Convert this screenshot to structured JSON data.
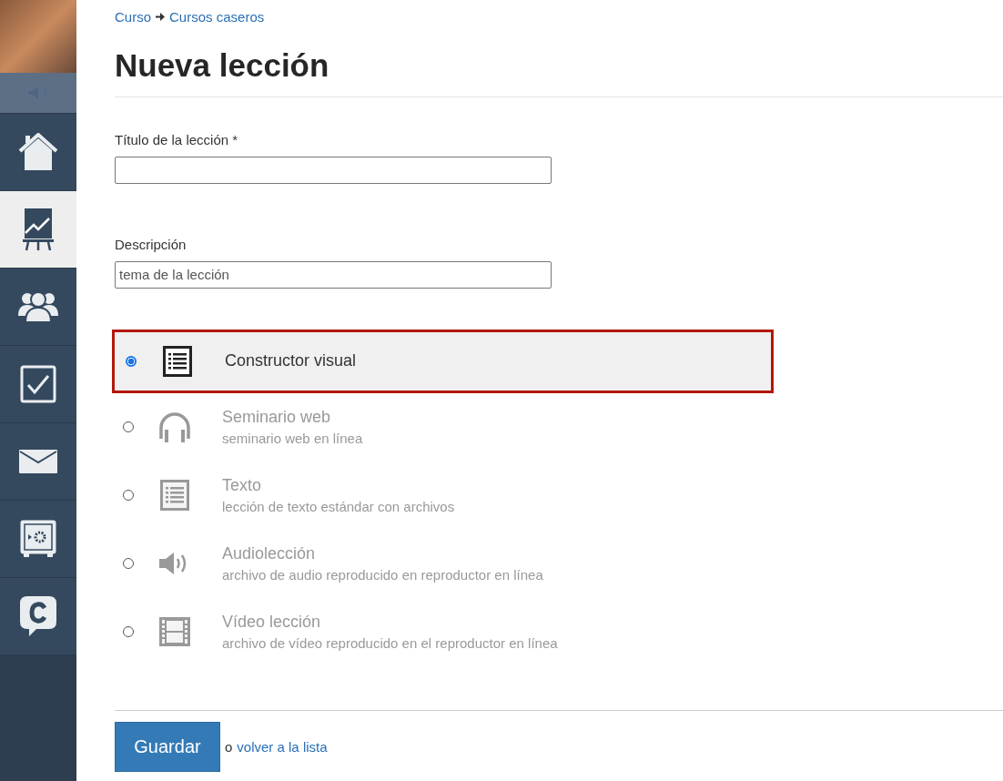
{
  "sidebar": {
    "items": [
      {
        "kind": "home",
        "selected": false
      },
      {
        "kind": "chart",
        "selected": true
      },
      {
        "kind": "users",
        "selected": false
      },
      {
        "kind": "tasks",
        "selected": false
      },
      {
        "kind": "mail",
        "selected": false
      },
      {
        "kind": "safe",
        "selected": false
      },
      {
        "kind": "chat",
        "selected": false
      }
    ]
  },
  "breadcrumb": [
    "Curso",
    "Cursos caseros"
  ],
  "heading": "Nueva lección",
  "fields": [
    {
      "label": "Título de la lección *"
    },
    {
      "label": "Descripción",
      "placeholder": "tema de la lección"
    }
  ],
  "lesson_types": [
    {
      "kind": "builder",
      "title": "Constructor visual",
      "selected": true
    },
    {
      "kind": "webinar",
      "title": "Seminario web",
      "description": "seminario web en línea",
      "selected": false
    },
    {
      "kind": "text",
      "title": "Texto",
      "description": "lección de texto estándar con archivos",
      "selected": false
    },
    {
      "kind": "audio",
      "title": "Audiolección",
      "description": "archivo de audio reproducido en reproductor en línea",
      "selected": false
    },
    {
      "kind": "video",
      "title": "Vídeo lección",
      "description": "archivo de vídeo reproducido en el reproductor en línea",
      "selected": false
    }
  ],
  "actions": {
    "save": "Guardar",
    "or": "o",
    "back_link": "volver a la lista"
  }
}
